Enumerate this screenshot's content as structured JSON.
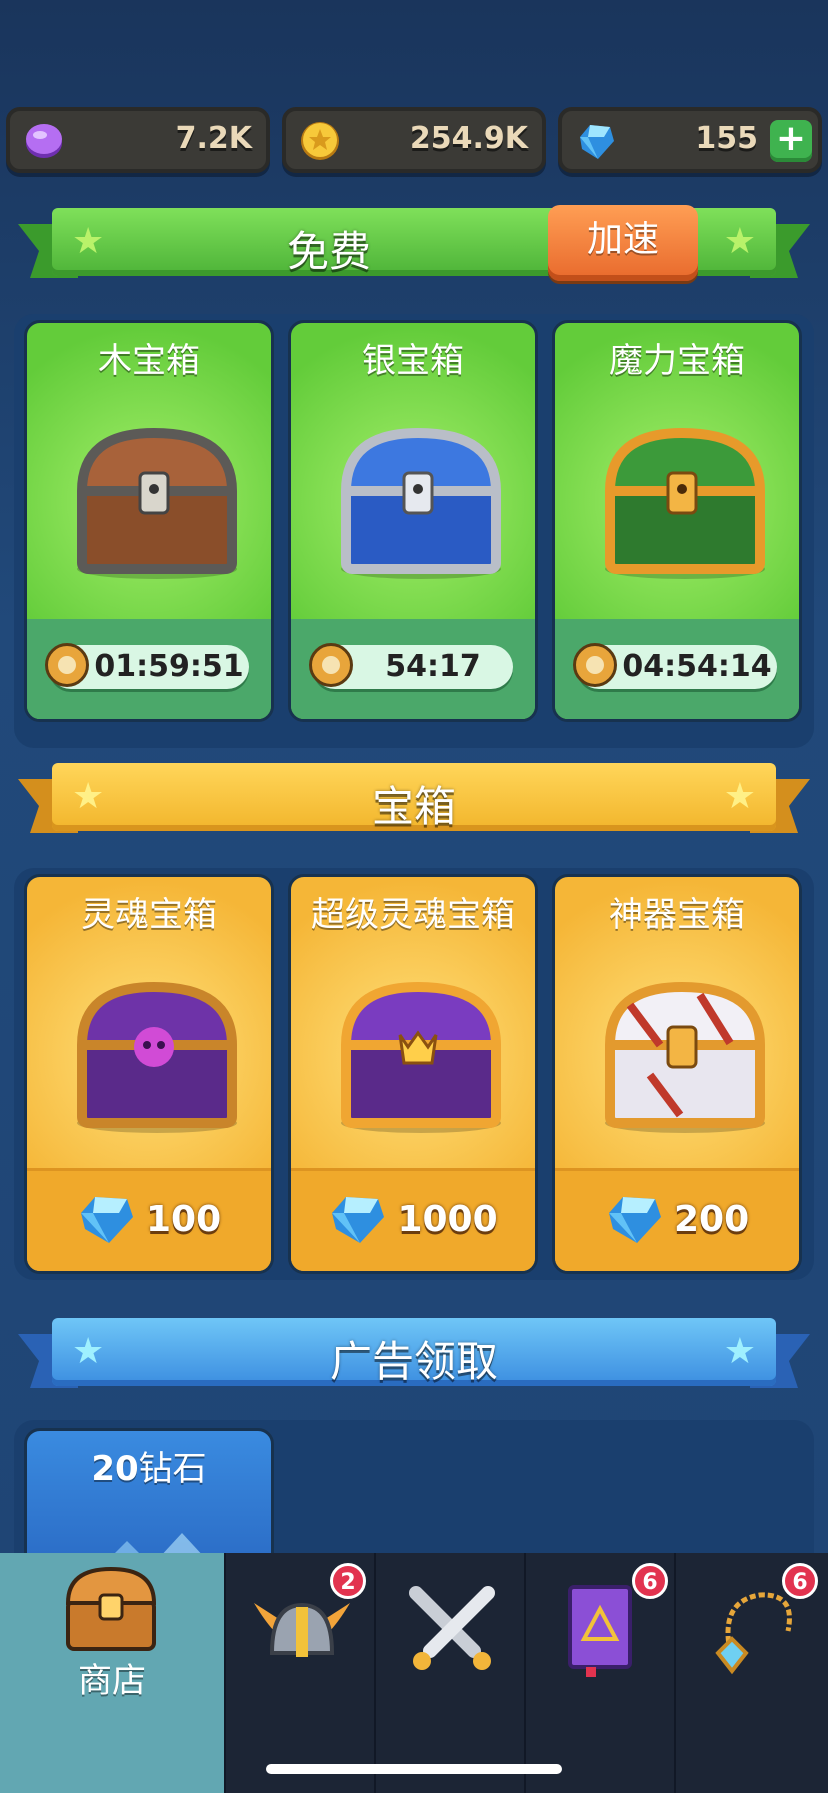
{
  "currencies": {
    "soul": {
      "value": "7.2K",
      "icon": "purple-soul-coin-icon"
    },
    "gold": {
      "value": "254.9K",
      "icon": "gold-coin-icon"
    },
    "gems": {
      "value": "155",
      "icon": "blue-gem-icon",
      "add_label": "+"
    }
  },
  "free_section": {
    "title": "免费",
    "speed_button": "加速"
  },
  "free_chests": [
    {
      "name": "木宝箱",
      "timer": "01:59:51"
    },
    {
      "name": "银宝箱",
      "timer": "54:17"
    },
    {
      "name": "魔力宝箱",
      "timer": "04:54:14"
    }
  ],
  "chest_section": {
    "title": "宝箱"
  },
  "paid_chests": [
    {
      "name": "灵魂宝箱",
      "price": "100"
    },
    {
      "name": "超级灵魂宝箱",
      "price": "1000"
    },
    {
      "name": "神器宝箱",
      "price": "200"
    }
  ],
  "ad_section": {
    "title": "广告领取"
  },
  "ad_offers": [
    {
      "label_amount": "20",
      "label_text": "钻石"
    }
  ],
  "nav": {
    "shop_label": "商店",
    "badges": {
      "heroes": "2",
      "spellbook": "6",
      "amulet": "6"
    }
  },
  "colors": {
    "green": "#63cc3a",
    "yellow": "#f5b637",
    "blue": "#3b8de0",
    "selected_tab": "#62a7b2"
  }
}
